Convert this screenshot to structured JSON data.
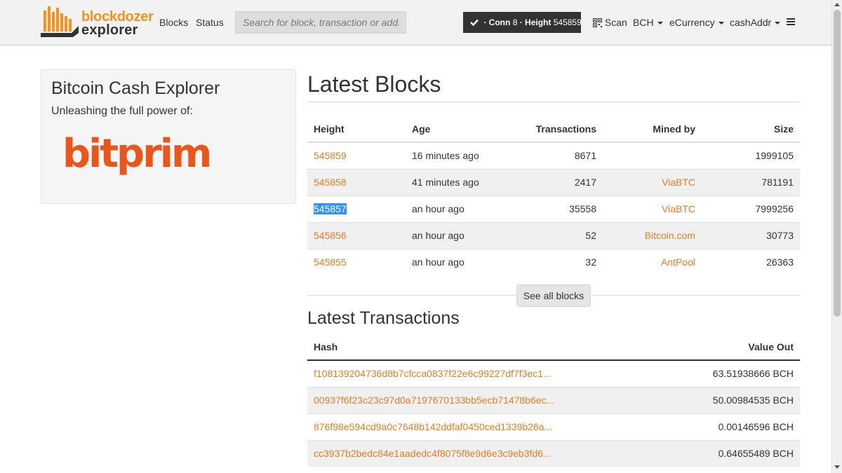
{
  "brand": {
    "line1": "blockdozer",
    "line2": "explorer"
  },
  "nav": {
    "blocks": "Blocks",
    "status": "Status"
  },
  "search": {
    "placeholder": "Search for block, transaction or address"
  },
  "status": {
    "conn_label": "· Conn",
    "conn": "8",
    "height_label": "· Height",
    "height": "545859"
  },
  "toolbar": {
    "scan": "Scan",
    "coin": "BCH",
    "currency": "eCurrency",
    "addr": "cashAddr"
  },
  "sidebar": {
    "title": "Bitcoin Cash Explorer",
    "subtitle": "Unleashing the full power of:",
    "logo_text": "bitprim"
  },
  "blocks": {
    "title": "Latest Blocks",
    "headers": {
      "height": "Height",
      "age": "Age",
      "transactions": "Transactions",
      "mined_by": "Mined by",
      "size": "Size"
    },
    "rows": [
      {
        "height": "545859",
        "age": "16 minutes ago",
        "transactions": "8671",
        "mined_by": "",
        "size": "1999105"
      },
      {
        "height": "545858",
        "age": "41 minutes ago",
        "transactions": "2417",
        "mined_by": "ViaBTC",
        "size": "781191"
      },
      {
        "height": "545857",
        "age": "an hour ago",
        "transactions": "35558",
        "mined_by": "ViaBTC",
        "size": "7999256"
      },
      {
        "height": "545856",
        "age": "an hour ago",
        "transactions": "52",
        "mined_by": "Bitcoin.com",
        "size": "30773"
      },
      {
        "height": "545855",
        "age": "an hour ago",
        "transactions": "32",
        "mined_by": "AntPool",
        "size": "26363"
      }
    ],
    "see_all": "See all blocks"
  },
  "transactions": {
    "title": "Latest Transactions",
    "headers": {
      "hash": "Hash",
      "value_out": "Value Out"
    },
    "rows": [
      {
        "hash": "f108139204736d8b7cfcca0837f22e6c99227df7f3ec1...",
        "value": "63.51938666 BCH"
      },
      {
        "hash": "00937f6f23c23c97d0a7197670133bb5ecb71478b6ec...",
        "value": "50.00984535 BCH"
      },
      {
        "hash": "876f98e594cd9a0c7648b142ddfaf0450ced1339b26a...",
        "value": "0.00146596 BCH"
      },
      {
        "hash": "cc3937b2bedc84e1aadedc4f8075f8e9d6e3c9eb3fd6...",
        "value": "0.64655489 BCH"
      }
    ]
  },
  "colors": {
    "accent": "#e67e22",
    "brand_orange": "#f7931a",
    "navbar_bg": "#f2f2f2",
    "pill_bg": "#333333"
  }
}
